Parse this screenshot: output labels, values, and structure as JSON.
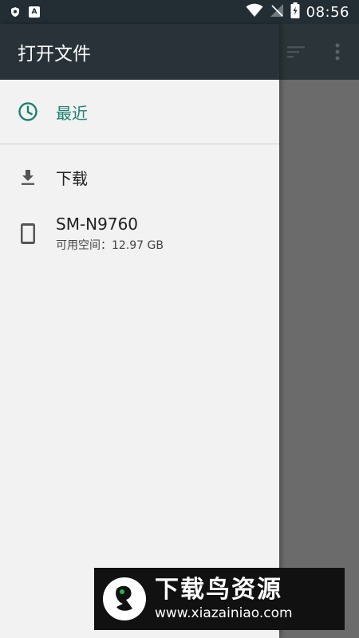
{
  "status_bar": {
    "time": "08:56",
    "notification_badge": "A",
    "icons": [
      "shield-icon",
      "a-badge-icon",
      "wifi-icon",
      "signal-icon",
      "battery-charging-icon"
    ]
  },
  "drawer": {
    "title": "打开文件",
    "items": [
      {
        "label": "最近",
        "icon": "clock-icon",
        "active": true
      },
      {
        "label": "下载",
        "icon": "download-icon"
      },
      {
        "label": "SM-N9760",
        "sub": "可用空间：12.97 GB",
        "icon": "phone-icon"
      }
    ]
  },
  "toolbar_icons": [
    "sort-icon",
    "overflow-menu-icon"
  ],
  "watermark": {
    "text": "下载鸟资源",
    "url": "www.xiazainiao.com"
  },
  "colors": {
    "status_bar": "#232e34",
    "drawer_header": "#283238",
    "drawer_bg": "#f2f2f2",
    "accent": "#1e7f73",
    "scrim": "#6b6b6b"
  }
}
